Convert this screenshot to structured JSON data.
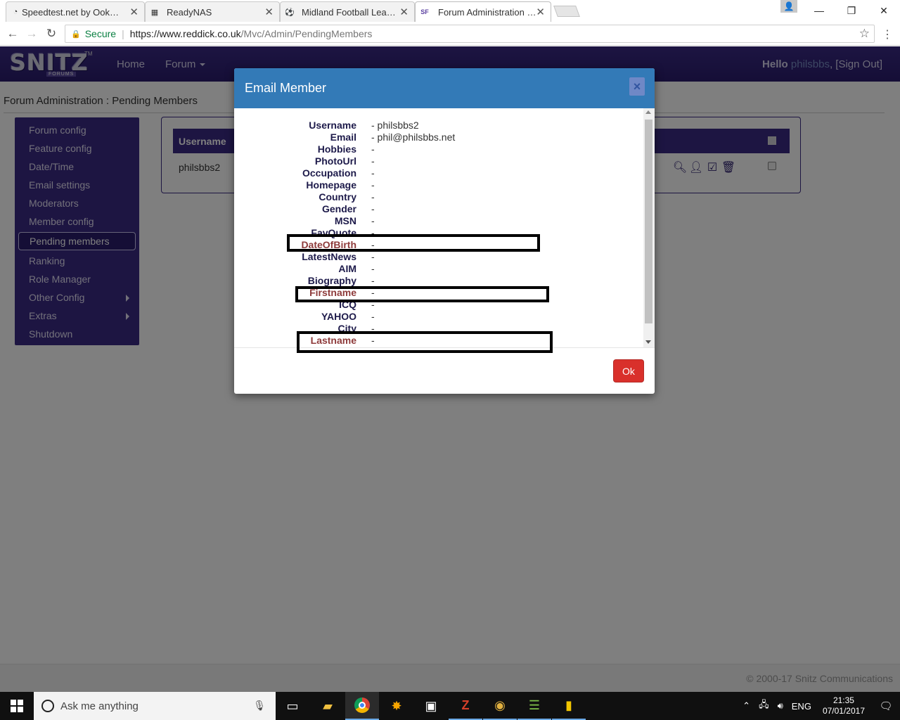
{
  "browser": {
    "tabs": [
      {
        "title": "Speedtest.net by Ookla -",
        "favicon": "speedtest-icon"
      },
      {
        "title": "ReadyNAS",
        "favicon": "readynas-icon"
      },
      {
        "title": "Midland Football League",
        "favicon": "football-icon"
      },
      {
        "title": "Forum Administration : P",
        "favicon": "snitz-icon",
        "active": true
      }
    ],
    "secure_label": "Secure",
    "url_host": "https://www.reddick.co.uk",
    "url_path": "/Mvc/Admin/PendingMembers"
  },
  "site": {
    "logo_text": "SNITZ",
    "logo_sub": "FORUMS",
    "logo_tm": "TM",
    "nav": {
      "home": "Home",
      "forum": "Forum"
    },
    "hello_label": "Hello",
    "username": "philsbbs",
    "signout": ", [Sign Out]"
  },
  "page": {
    "breadcrumb": "Forum Administration : Pending Members",
    "menu": [
      {
        "label": "Forum config"
      },
      {
        "label": "Feature config"
      },
      {
        "label": "Date/Time"
      },
      {
        "label": "Email settings"
      },
      {
        "label": "Moderators"
      },
      {
        "label": "Member config"
      },
      {
        "label": "Pending members",
        "active": true
      },
      {
        "label": "Ranking"
      },
      {
        "label": "Role Manager"
      },
      {
        "label": "Other Config",
        "submenu": true
      },
      {
        "label": "Extras",
        "submenu": true
      },
      {
        "label": "Shutdown"
      }
    ],
    "table": {
      "column_username": "Username",
      "rows": [
        {
          "username": "philsbbs2"
        }
      ]
    },
    "footer": "© 2000-17 Snitz Communications"
  },
  "modal": {
    "title": "Email Member",
    "close": "×",
    "ok_label": "Ok",
    "fields": [
      {
        "label": "Username",
        "value": "- philsbbs2"
      },
      {
        "label": "Email",
        "value": "- phil@philsbbs.net"
      },
      {
        "label": "Hobbies",
        "value": "-"
      },
      {
        "label": "PhotoUrl",
        "value": "-"
      },
      {
        "label": "Occupation",
        "value": "-"
      },
      {
        "label": "Homepage",
        "value": "-"
      },
      {
        "label": "Country",
        "value": "-"
      },
      {
        "label": "Gender",
        "value": "-"
      },
      {
        "label": "MSN",
        "value": "-"
      },
      {
        "label": "FavQuote",
        "value": "-"
      },
      {
        "label": "DateOfBirth",
        "value": "-",
        "highlight": true
      },
      {
        "label": "LatestNews",
        "value": "-"
      },
      {
        "label": "AIM",
        "value": "-"
      },
      {
        "label": "Biography",
        "value": "-"
      },
      {
        "label": "Firstname",
        "value": "-",
        "highlight": true
      },
      {
        "label": "ICQ",
        "value": "-"
      },
      {
        "label": "YAHOO",
        "value": "-"
      },
      {
        "label": "City",
        "value": "-"
      },
      {
        "label": "Lastname",
        "value": "-",
        "highlight": true
      }
    ]
  },
  "taskbar": {
    "search_placeholder": "Ask me anything",
    "language": "ENG",
    "time": "21:35",
    "date": "07/01/2017"
  }
}
